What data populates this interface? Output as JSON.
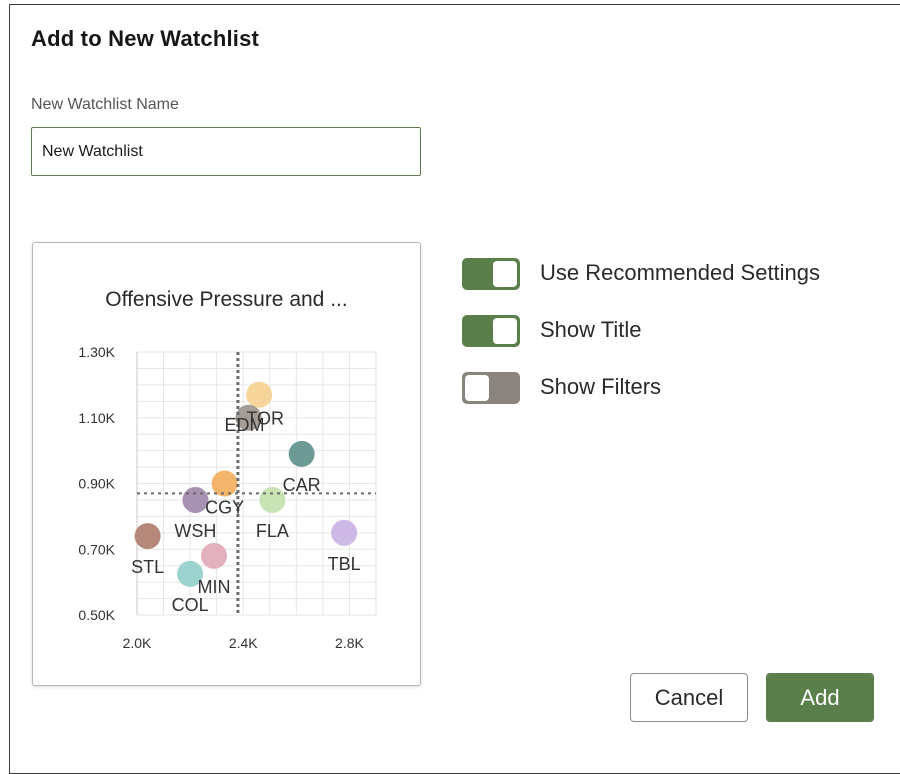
{
  "dialog": {
    "title": "Add to New Watchlist",
    "name_label": "New Watchlist Name",
    "name_value": "New Watchlist"
  },
  "options": [
    {
      "label": "Use Recommended Settings",
      "on": true
    },
    {
      "label": "Show Title",
      "on": true
    },
    {
      "label": "Show Filters",
      "on": false
    }
  ],
  "buttons": {
    "cancel": "Cancel",
    "add": "Add"
  },
  "colors": {
    "accent": "#5b7f4a",
    "toggle_off": "#8a847e"
  },
  "chart_data": {
    "type": "scatter",
    "title": "Offensive Pressure and ...",
    "xlim": [
      2000,
      2900
    ],
    "ylim": [
      500,
      1300
    ],
    "x_ticks": [
      "2.0K",
      "2.4K",
      "2.8K"
    ],
    "x_tick_values": [
      2000,
      2400,
      2800
    ],
    "y_ticks": [
      "1.30K",
      "1.10K",
      "0.90K",
      "0.70K",
      "0.50K"
    ],
    "y_tick_values": [
      1300,
      1100,
      900,
      700,
      500
    ],
    "reference_lines": {
      "x": 2380,
      "y": 870
    },
    "grid": true,
    "points": [
      {
        "label": "TOR",
        "x": 2460,
        "y": 1170,
        "color": "#f6d59a"
      },
      {
        "label": "EDM",
        "x": 2420,
        "y": 1100,
        "color": "#a49d97"
      },
      {
        "label": "CAR",
        "x": 2620,
        "y": 990,
        "color": "#6e9a96"
      },
      {
        "label": "CGY",
        "x": 2330,
        "y": 900,
        "color": "#f2b56a"
      },
      {
        "label": "WSH",
        "x": 2220,
        "y": 850,
        "color": "#a892b2"
      },
      {
        "label": "FLA",
        "x": 2510,
        "y": 850,
        "color": "#c8e3b4"
      },
      {
        "label": "STL",
        "x": 2040,
        "y": 740,
        "color": "#b58979"
      },
      {
        "label": "TBL",
        "x": 2780,
        "y": 750,
        "color": "#cdb8e6"
      },
      {
        "label": "MIN",
        "x": 2290,
        "y": 680,
        "color": "#e2b1bd"
      },
      {
        "label": "COL",
        "x": 2200,
        "y": 625,
        "color": "#9bd3cf"
      }
    ]
  }
}
